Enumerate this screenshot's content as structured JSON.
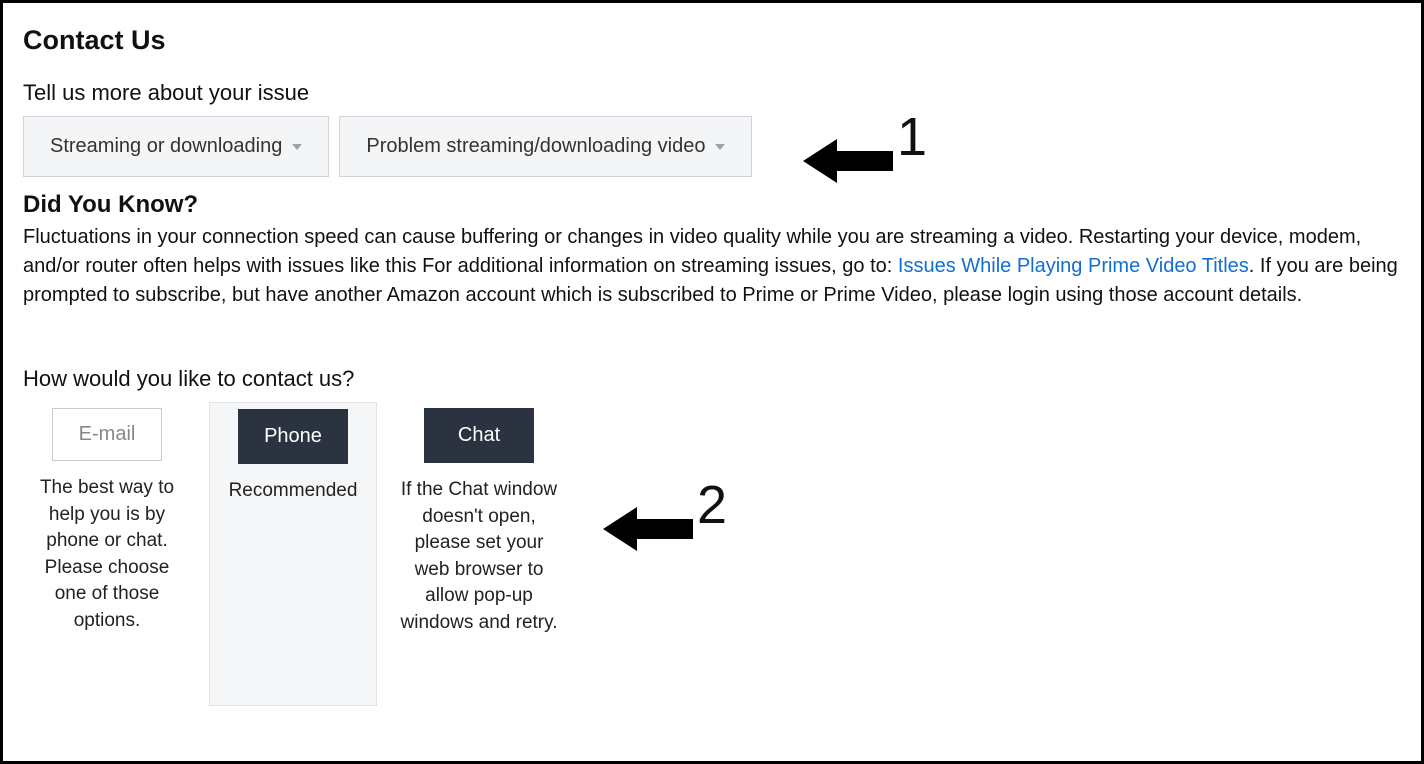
{
  "header": {
    "title": "Contact Us"
  },
  "issue": {
    "prompt": "Tell us more about your issue",
    "dropdown1": "Streaming or downloading",
    "dropdown2": "Problem streaming/downloading video"
  },
  "didYouKnow": {
    "title": "Did You Know?",
    "text_pre_link": "Fluctuations in your connection speed can cause buffering or changes in video quality while you are streaming a video. Restarting your device, modem, and/or router often helps with issues like this For additional information on streaming issues, go to: ",
    "link_text": "Issues While Playing Prime Video Titles",
    "text_post_link": ". If you are being prompted to subscribe, but have another Amazon account which is subscribed to Prime or Prime Video, please login using those account details."
  },
  "contact": {
    "prompt": "How would you like to contact us?",
    "options": {
      "email": {
        "button": "E-mail",
        "desc": "The best way to help you is by phone or chat. Please choose one of those options."
      },
      "phone": {
        "button": "Phone",
        "desc": "Recommended"
      },
      "chat": {
        "button": "Chat",
        "desc": "If the Chat window doesn't open, please set your web browser to allow pop-up windows and retry."
      }
    }
  },
  "annotations": {
    "arrow1_label": "1",
    "arrow2_label": "2"
  }
}
